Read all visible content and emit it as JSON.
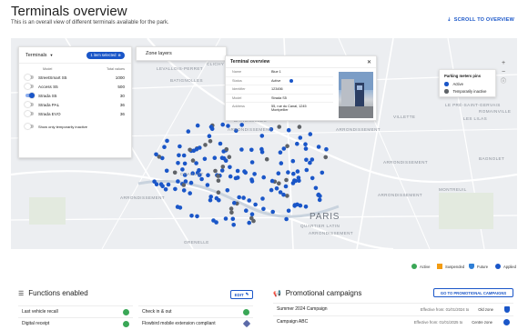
{
  "header": {
    "title": "Terminals overview",
    "subtitle": "This is an overall view of different terminals available for the park.",
    "scroll_link": "SCROLL TO OVERVIEW"
  },
  "map": {
    "labels": [
      "LEVALLOIS-PERRET",
      "CLICHY",
      "BATIGNOLLES",
      "ARRONDISSEMENT",
      "ARRONDISSEMENT",
      "BATIGNOLLES",
      "VILLETTE",
      "LE PRÉ-SAINT-GERVAIS",
      "LES LILAS",
      "ROMAINVILLE",
      "BAGNOLET",
      "MONTREUIL",
      "ARRONDISSEMENT",
      "ARRONDISSEMENT",
      "CHAILLOT",
      "ARRONDISSEMENT",
      "ARRONDISSEMENT",
      "GRENELLE",
      "QUARTIER LATIN"
    ],
    "city_label": "PARIS"
  },
  "terminals_panel": {
    "title": "Terminals",
    "selected_pill": "1 item selected",
    "col_model": "Model",
    "col_total": "Total values",
    "rows": [
      {
        "model": "StreetSmart S5",
        "value": "1000",
        "on": false
      },
      {
        "model": "Access S5",
        "value": "500",
        "on": false
      },
      {
        "model": "Strada S5",
        "value": "30",
        "on": true
      },
      {
        "model": "Strada PAL",
        "value": "36",
        "on": false
      },
      {
        "model": "Strada EVO",
        "value": "36",
        "on": false
      }
    ],
    "inactive_label": "Show only temporarily inactive"
  },
  "zone_layers": {
    "label": "Zone layers"
  },
  "terminal_popup": {
    "title": "Terminal overview",
    "rows": [
      {
        "key": "Name",
        "value": "Blue 1"
      },
      {
        "key": "Status",
        "value": "Active"
      },
      {
        "key": "Identifier",
        "value": "123456"
      },
      {
        "key": "Model",
        "value": "Strada S5"
      },
      {
        "key": "Address",
        "value": "55, rue du Canal, 1245 Montpellier"
      }
    ]
  },
  "legend": {
    "title": "Parking meters pins",
    "items": [
      {
        "label": "Active",
        "color": "#1a56c8"
      },
      {
        "label": "Temporarily inactive",
        "color": "#5f6368"
      }
    ]
  },
  "map_controls": {
    "zoom_in": "+",
    "zoom_out": "−",
    "info": "ⓘ"
  },
  "status_legend": [
    {
      "label": "Active",
      "color": "#3aa756",
      "shape": "circle"
    },
    {
      "label": "Suspended",
      "color": "#f39c12",
      "shape": "square"
    },
    {
      "label": "Future",
      "color": "#2f7fd6",
      "shape": "shield"
    },
    {
      "label": "Applied",
      "color": "#1a56c8",
      "shape": "circle"
    }
  ],
  "functions": {
    "title": "Functions enabled",
    "edit": "EDIT",
    "left": [
      {
        "label": "Last vehicle recall",
        "color": "#3aa756"
      },
      {
        "label": "Digital receipt",
        "color": "#3aa756"
      }
    ],
    "right": [
      {
        "label": "Check in & out",
        "color": "#3aa756"
      },
      {
        "label": "Flowbird mobile extension compliant",
        "color": "#5b6aa8"
      }
    ]
  },
  "promotional": {
    "title": "Promotional campaigns",
    "button": "GO TO PROMOTIONAL CAMPAIGNS",
    "rows": [
      {
        "name": "Summer 2024 Campaign",
        "effective": "Effective from: 01/01/2024",
        "to": "to",
        "zone": "Old zone"
      },
      {
        "name": "Campaign ABC",
        "effective": "Effective from: 01/01/2025",
        "to": "to",
        "zone": "Centre zone"
      }
    ]
  }
}
